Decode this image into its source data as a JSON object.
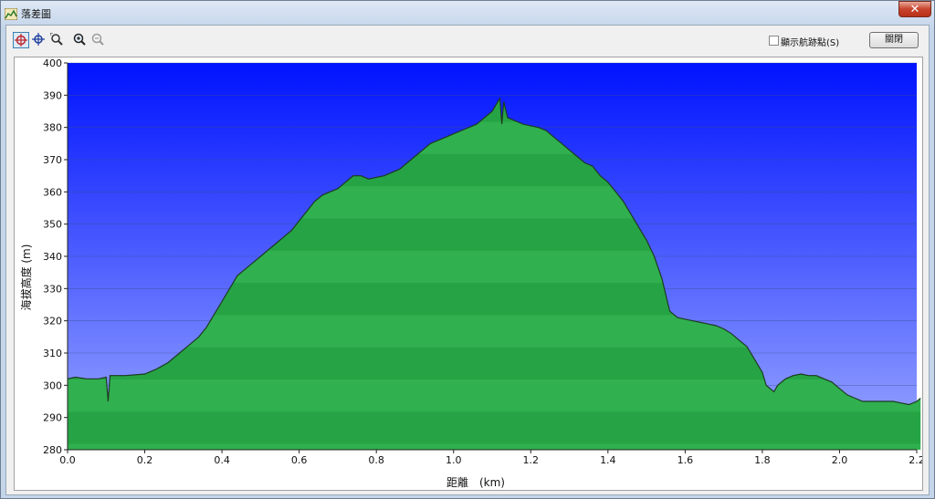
{
  "window": {
    "title": "落差圖",
    "close_glyph": "✕"
  },
  "toolbar": {
    "tools": [
      {
        "name": "crosshair-select-icon",
        "active": true
      },
      {
        "name": "crosshair-icon",
        "active": false
      },
      {
        "name": "zoom-area-icon",
        "active": false
      },
      {
        "name": "zoom-in-icon",
        "active": false
      },
      {
        "name": "zoom-out-icon",
        "active": false
      }
    ],
    "show_trackpoints_label": "顯示航跡點(S)",
    "show_trackpoints_checked": false,
    "close_button_label": "關閉"
  },
  "colors": {
    "sky_top": "#0013ff",
    "sky_bottom": "#9aa8ff",
    "terrain": "#26a445",
    "terrain_dark": "#137a2c",
    "outline": "#1d3b1f"
  },
  "chart_data": {
    "type": "area",
    "xlabel": "距離　(km)",
    "ylabel": "海拔高度 (m)",
    "xlim": [
      0.0,
      2.2
    ],
    "ylim": [
      280,
      400
    ],
    "x_ticks": [
      "0.0",
      "0.2",
      "0.4",
      "0.6",
      "0.8",
      "1.0",
      "1.2",
      "1.4",
      "1.6",
      "1.8",
      "2.0",
      "2.2"
    ],
    "y_ticks": [
      "400",
      "390",
      "380",
      "370",
      "360",
      "350",
      "340",
      "330",
      "320",
      "310",
      "300",
      "290",
      "280"
    ],
    "grid": true,
    "series": [
      {
        "x": [
          0.0,
          0.02,
          0.05,
          0.08,
          0.1,
          0.105,
          0.11,
          0.15,
          0.2,
          0.23,
          0.26,
          0.28,
          0.3,
          0.32,
          0.34,
          0.36,
          0.38,
          0.4,
          0.42,
          0.44,
          0.46,
          0.48,
          0.5,
          0.52,
          0.54,
          0.56,
          0.58,
          0.6,
          0.62,
          0.64,
          0.66,
          0.68,
          0.7,
          0.72,
          0.74,
          0.76,
          0.78,
          0.8,
          0.82,
          0.84,
          0.86,
          0.88,
          0.9,
          0.92,
          0.94,
          0.96,
          0.98,
          1.0,
          1.02,
          1.04,
          1.06,
          1.08,
          1.1,
          1.11,
          1.12,
          1.125,
          1.13,
          1.14,
          1.16,
          1.18,
          1.2,
          1.22,
          1.24,
          1.26,
          1.28,
          1.3,
          1.32,
          1.34,
          1.36,
          1.38,
          1.4,
          1.42,
          1.44,
          1.46,
          1.48,
          1.5,
          1.52,
          1.54,
          1.56,
          1.58,
          1.6,
          1.62,
          1.64,
          1.66,
          1.68,
          1.7,
          1.72,
          1.74,
          1.76,
          1.78,
          1.8,
          1.81,
          1.82,
          1.83,
          1.84,
          1.86,
          1.88,
          1.9,
          1.92,
          1.94,
          1.96,
          1.98,
          2.0,
          2.02,
          2.04,
          2.06,
          2.08,
          2.1,
          2.12,
          2.14,
          2.16,
          2.18,
          2.2,
          2.21
        ],
        "y": [
          302,
          302.5,
          302,
          302,
          302.5,
          295,
          303,
          303,
          303.5,
          305,
          307,
          309,
          311,
          313,
          315,
          318,
          322,
          326,
          330,
          334,
          336,
          338,
          340,
          342,
          344,
          346,
          348,
          351,
          354,
          357,
          359,
          360,
          361,
          363,
          365,
          365,
          364,
          364.5,
          365,
          366,
          367,
          369,
          371,
          373,
          375,
          376,
          377,
          378,
          379,
          380,
          381,
          383,
          385,
          387,
          389,
          381,
          388,
          383,
          382,
          381,
          380.5,
          380,
          379,
          377,
          375,
          373,
          371,
          369,
          368,
          365,
          363,
          360,
          357,
          353,
          349,
          345,
          340,
          333,
          323,
          321,
          320.5,
          320,
          319.5,
          319,
          318.5,
          317.5,
          316,
          314,
          312,
          308,
          304,
          300,
          299,
          298,
          300,
          302,
          303,
          303.5,
          303,
          303,
          302,
          301,
          299,
          297,
          296,
          295,
          295,
          295,
          295,
          295,
          294.5,
          294,
          295,
          296
        ]
      }
    ]
  }
}
